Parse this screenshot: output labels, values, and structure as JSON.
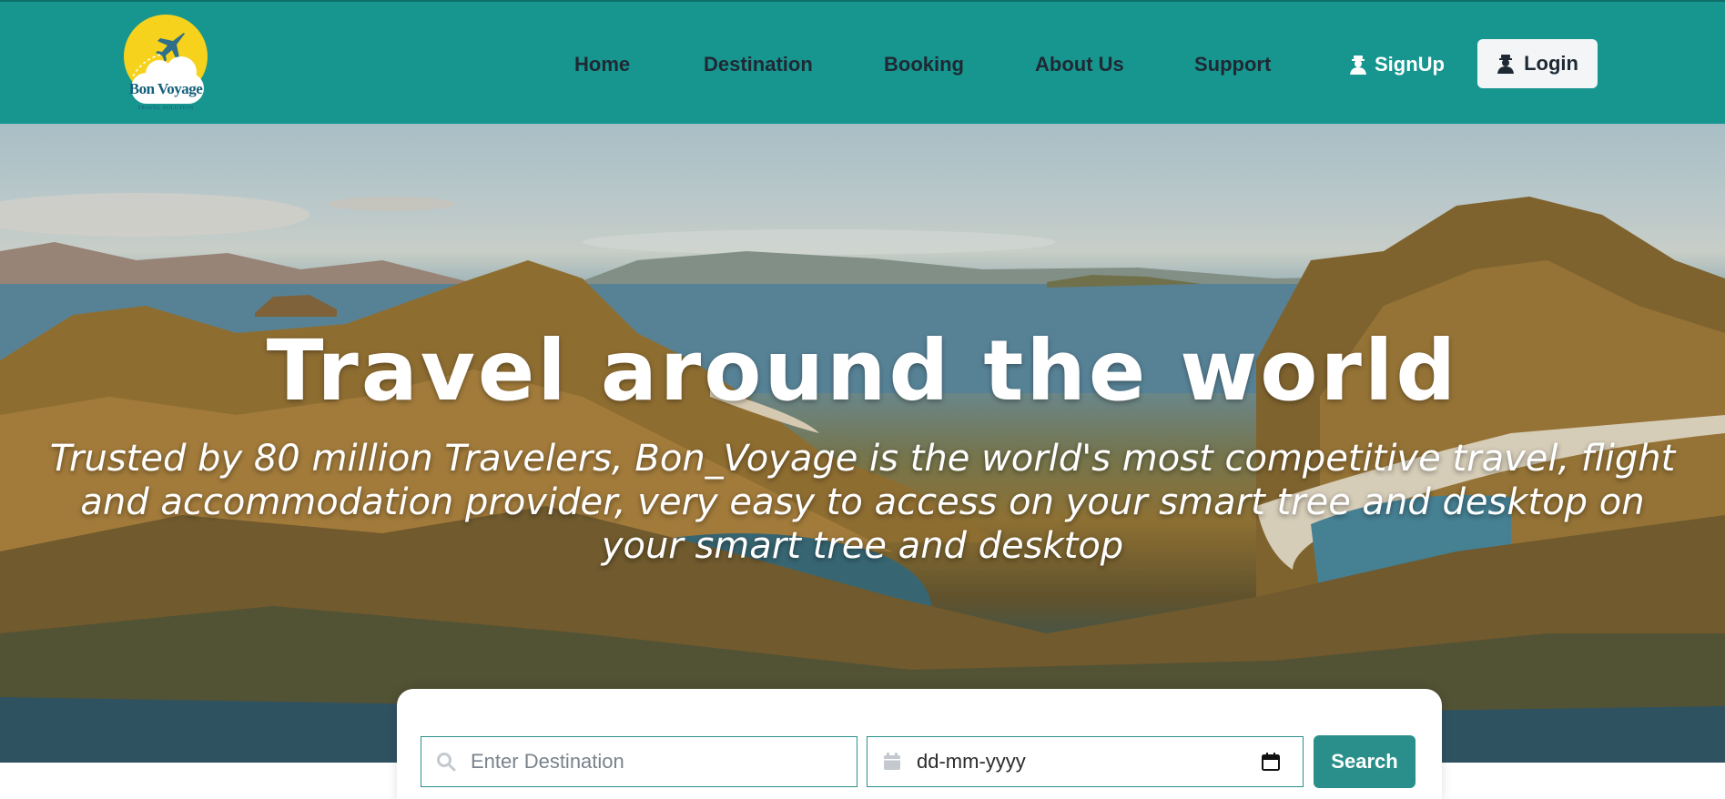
{
  "brand": {
    "name": "Bon Voyage",
    "tagline": "TRAVEL SOLUTION"
  },
  "nav": {
    "links": [
      "Home",
      "Destination",
      "Booking",
      "About Us",
      "Support"
    ],
    "signup_label": "SignUp",
    "login_label": "Login"
  },
  "hero": {
    "title": "Travel around the world",
    "subtitle": "Trusted by 80 million Travelers, Bon_Voyage is the world's most competitive travel, flight and accommodation provider, very easy to access on your smart tree and desktop on your smart tree and desktop"
  },
  "search": {
    "destination_placeholder": "Enter Destination",
    "date_placeholder": "dd-mm-yyyy",
    "button_label": "Search"
  },
  "colors": {
    "navbar": "#17958f",
    "accent": "#2a8f8a",
    "login_bg": "#f3f5f7",
    "logo_sun": "#f6d21c"
  },
  "icons": [
    "plane-icon",
    "user-icon",
    "search-icon",
    "calendar-icon"
  ]
}
